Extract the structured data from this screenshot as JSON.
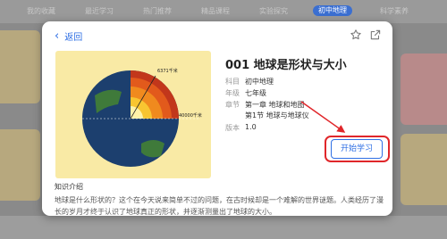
{
  "background": {
    "tabs": [
      "我的收藏",
      "最近学习",
      "热门推荐",
      "精品课程",
      "实验探究",
      "科学素养"
    ],
    "active_tab": "初中地理"
  },
  "modal": {
    "back_label": "返回",
    "title": "001 地球是形状与大小",
    "meta": [
      {
        "key": "科目",
        "value": "初中地理"
      },
      {
        "key": "年级",
        "value": "七年级"
      },
      {
        "key": "章节",
        "value": "第一章 地球和地图"
      },
      {
        "key": "",
        "value": "第1节 地球与地球仪"
      },
      {
        "key": "版本",
        "value": "1.0"
      }
    ],
    "start_label": "开始学习",
    "intro_title": "知识介绍",
    "intro_text": "地球是什么形状的？这个在今天说来简单不过的问题，在古时候却是一个难解的世界谜题。人类经历了漫长的岁月才终于认识了地球真正的形状，并逐渐测量出了地球的大小。",
    "thumbnail": {
      "label_outer": "6371千米",
      "label_inner": "40000千米"
    }
  },
  "colors": {
    "accent": "#2f6fe4",
    "highlight": "#e0262a",
    "thumb_bg": "#f9eaa5"
  }
}
